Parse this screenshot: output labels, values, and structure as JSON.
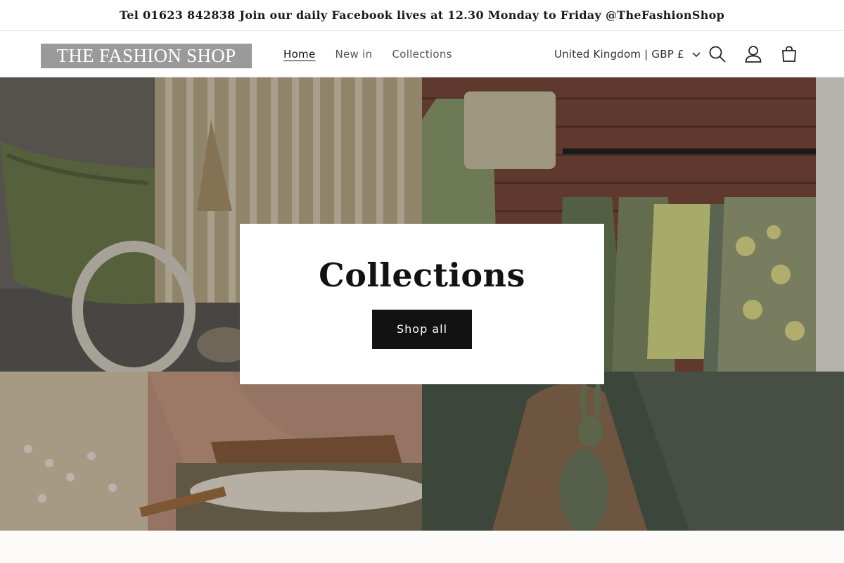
{
  "announcement": {
    "text": "Tel 01623 842838 Join our daily Facebook lives at 12.30 Monday to Friday @TheFashionShop"
  },
  "header": {
    "logo_text": "THE FASHION SHOP",
    "nav": [
      {
        "label": "Home",
        "active": true
      },
      {
        "label": "New in",
        "active": false
      },
      {
        "label": "Collections",
        "active": false
      }
    ],
    "country_selector": "United Kingdom | GBP £",
    "icons": [
      "search-icon",
      "account-icon",
      "cart-icon"
    ]
  },
  "hero": {
    "heading": "Collections",
    "button_label": "Shop all"
  },
  "colors": {
    "logo_bg": "#9a9a9a",
    "button_bg": "#121212",
    "text": "#121212"
  }
}
